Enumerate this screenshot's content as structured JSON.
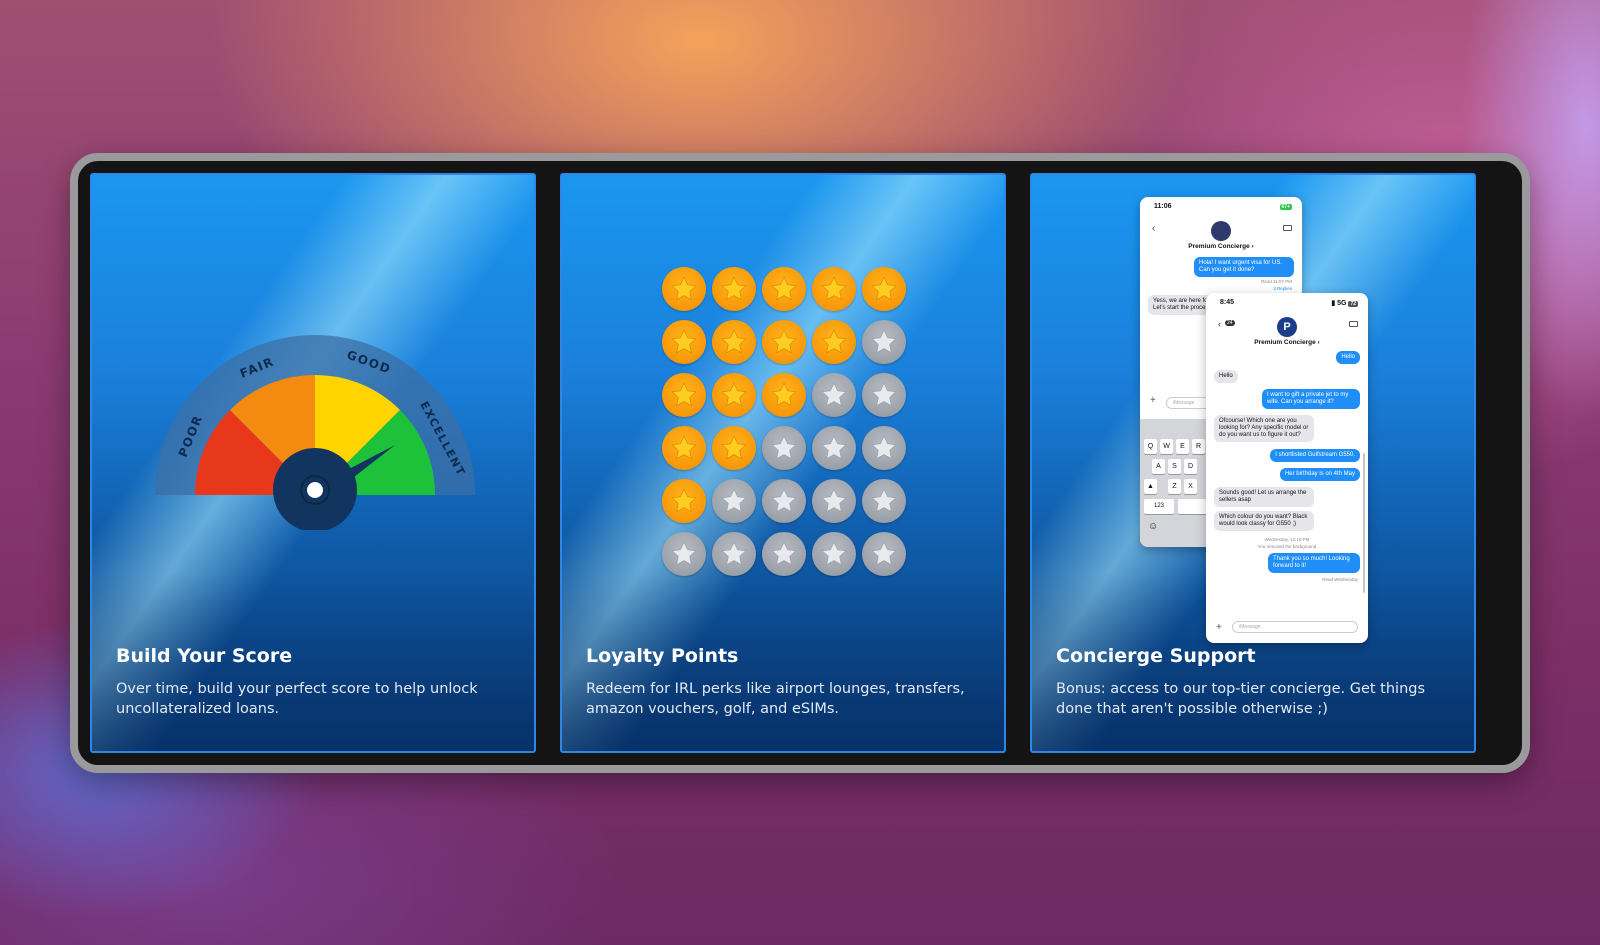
{
  "cards": [
    {
      "title": "Build Your Score",
      "description": "Over time, build your perfect score to help unlock uncollateralized loans.",
      "gauge": {
        "labels": [
          "POOR",
          "FAIR",
          "GOOD",
          "EXCELLENT"
        ],
        "colors": [
          "#e8381c",
          "#f58a10",
          "#ffd400",
          "#1ec13a"
        ]
      }
    },
    {
      "title": "Loyalty Points",
      "description": "Redeem for IRL perks like airport lounges, transfers, amazon vouchers, golf, and eSIMs.",
      "stars": {
        "rows": [
          [
            1,
            1,
            1,
            1,
            1
          ],
          [
            1,
            1,
            1,
            1,
            0
          ],
          [
            1,
            1,
            1,
            0,
            0
          ],
          [
            1,
            1,
            0,
            0,
            0
          ],
          [
            1,
            0,
            0,
            0,
            0
          ],
          [
            0,
            0,
            0,
            0,
            0
          ]
        ],
        "gold_color": "#ffcc22",
        "grey_color": "#e9eaee"
      }
    },
    {
      "title": "Concierge Support",
      "description": "Bonus: access to our top-tier concierge. Get things done that aren't possible otherwise ;)"
    }
  ],
  "phone_back": {
    "time": "11:06",
    "battery": "67+",
    "contact": "Premium Concierge ›",
    "messages": {
      "m1": "Hola! I want urgent visa for US. Can you get it done?",
      "m1_meta": "Read 11:07 PM",
      "m1_replies": "3 Replies",
      "m2": "Yess, we are here for you! Let's start the process"
    },
    "input_placeholder": "iMessage",
    "keys": [
      "Q",
      "W",
      "E",
      "R",
      "A",
      "S",
      "D",
      "Z",
      "X",
      "123"
    ]
  },
  "phone_front": {
    "time": "8:45",
    "signal": "5G",
    "battery": "72",
    "back_count": "24",
    "avatar_letter": "P",
    "contact": "Premium Concierge ›",
    "messages": {
      "m1": "Hello",
      "m2": "Hello",
      "m3": "I want to gift a private jet to my wife. Can you arrange it?",
      "m4": "Ofcourse! Which one are you looking for? Any specific model or do you want us to figure it out?",
      "m5": "I shortlisted Gulfstream G550.",
      "m6": "Her birthday is on 4th May",
      "m7": "Sounds good! Let us arrange the sellers asap",
      "m8": "Which colour do you want? Black would look classy for G550 ;)",
      "meta1": "Wednesday, 12:19 PM",
      "meta2": "You removed the background",
      "m9": "Thank you so much! Looking forward to it!",
      "meta3": "Read Wednesday"
    },
    "input_placeholder": "iMessage"
  }
}
